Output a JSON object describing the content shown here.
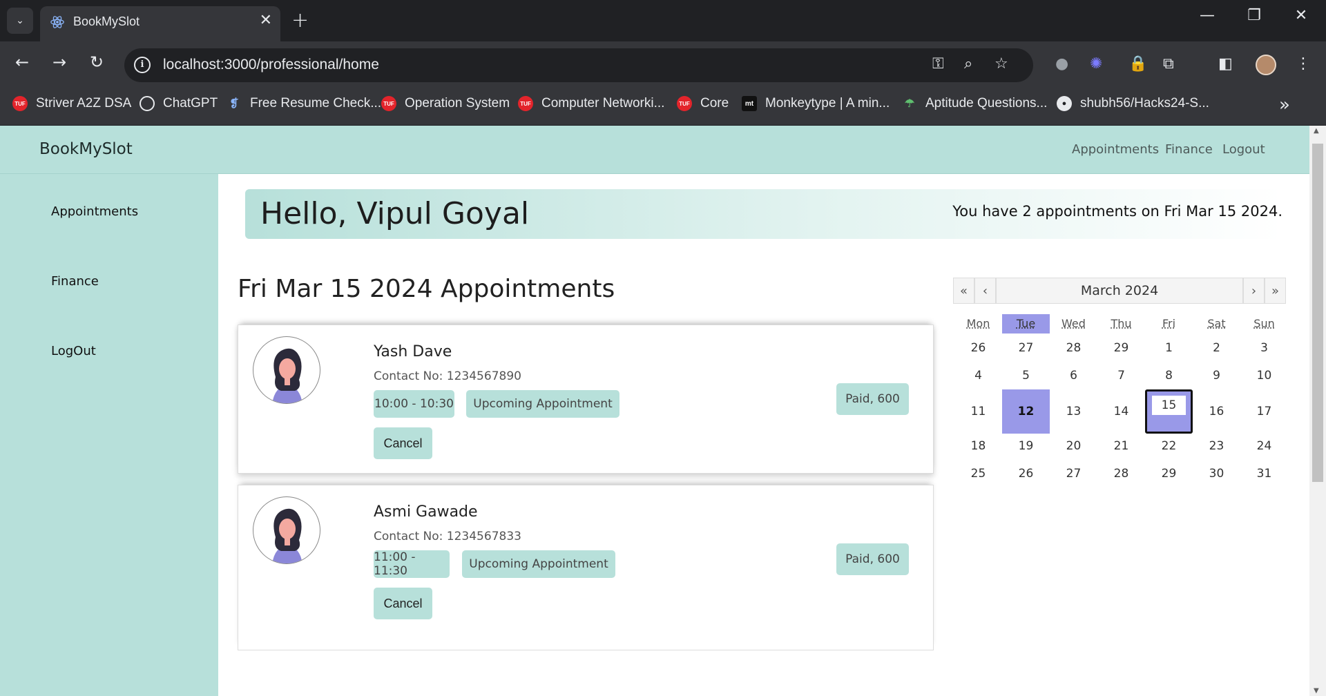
{
  "browser": {
    "tab_title": "BookMySlot",
    "url": "localhost:3000/professional/home",
    "bookmarks": [
      {
        "label": "Striver A2Z DSA",
        "icon": "tuf"
      },
      {
        "label": "ChatGPT",
        "icon": "chatgpt"
      },
      {
        "label": "Free Resume Check...",
        "icon": "resume"
      },
      {
        "label": "Operation System",
        "icon": "tuf"
      },
      {
        "label": "Computer Networki...",
        "icon": "tuf"
      },
      {
        "label": "Core",
        "icon": "tuf"
      },
      {
        "label": "Monkeytype | A min...",
        "icon": "monkeytype"
      },
      {
        "label": "Aptitude Questions...",
        "icon": "aptitude"
      },
      {
        "label": "shubh56/Hacks24-S...",
        "icon": "github"
      }
    ],
    "tuf_badge": "TUF",
    "monkeytype_badge": "mt"
  },
  "navbar": {
    "brand": "BookMySlot",
    "links": [
      "Appointments",
      "Finance",
      "Logout"
    ]
  },
  "sidebar": {
    "items": [
      "Appointments",
      "Finance",
      "LogOut"
    ]
  },
  "banner": {
    "greeting": "Hello, Vipul Goyal",
    "summary": "You have 2 appointments on Fri Mar 15 2024."
  },
  "day_heading": "Fri Mar 15 2024 Appointments",
  "appointments": [
    {
      "name": "Yash Dave",
      "contact": "Contact No: 1234567890",
      "time": "10:00 - 10:30",
      "status": "Upcoming Appointment",
      "action": "Cancel",
      "payment": "Paid, 600"
    },
    {
      "name": "Asmi Gawade",
      "contact": "Contact No: 1234567833",
      "time": "11:00 - 11:30",
      "status": "Upcoming Appointment",
      "action": "Cancel",
      "payment": "Paid, 600"
    }
  ],
  "calendar": {
    "nav": {
      "prev_year": "«",
      "prev_month": "‹",
      "next_month": "›",
      "next_year": "»"
    },
    "month_label": "March 2024",
    "weekdays": [
      "Mon",
      "Tue",
      "Wed",
      "Thu",
      "Fri",
      "Sat",
      "Sun"
    ],
    "weeks": [
      [
        "26",
        "27",
        "28",
        "29",
        "1",
        "2",
        "3"
      ],
      [
        "4",
        "5",
        "6",
        "7",
        "8",
        "9",
        "10"
      ],
      [
        "11",
        "12",
        "13",
        "14",
        "15",
        "16",
        "17"
      ],
      [
        "18",
        "19",
        "20",
        "21",
        "22",
        "23",
        "24"
      ],
      [
        "25",
        "26",
        "27",
        "28",
        "29",
        "30",
        "31"
      ]
    ],
    "today": "12",
    "selected": "15"
  },
  "colors": {
    "accent": "#b7e0da",
    "highlight": "#9999e8"
  }
}
